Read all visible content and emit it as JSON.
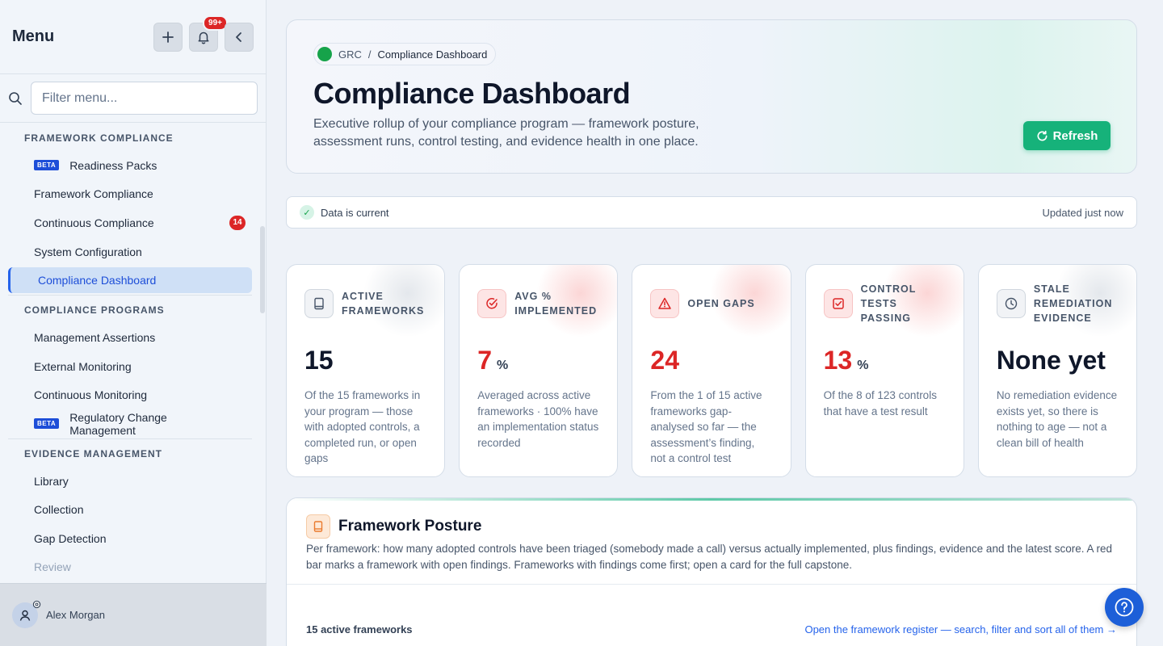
{
  "sidebar": {
    "title": "Menu",
    "notif_count": "99+",
    "filter_placeholder": "Filter menu...",
    "sections": [
      {
        "title": "FRAMEWORK COMPLIANCE"
      },
      {
        "title": "COMPLIANCE PROGRAMS"
      },
      {
        "title": "EVIDENCE MANAGEMENT"
      }
    ],
    "items": {
      "readiness": "Readiness Packs",
      "framework_compliance": "Framework Compliance",
      "continuous_compliance": "Continuous Compliance",
      "continuous_compliance_count": "14",
      "system_configuration": "System Configuration",
      "compliance_dashboard": "Compliance Dashboard",
      "management_assertions": "Management Assertions",
      "external_monitoring": "External Monitoring",
      "continuous_monitoring": "Continuous Monitoring",
      "regulatory_change": "Regulatory Change Management",
      "library": "Library",
      "collection": "Collection",
      "gap_detection": "Gap Detection",
      "review": "Review"
    },
    "beta_label": "BETA",
    "user_name": "Alex Morgan"
  },
  "hero": {
    "crumb_root": "GRC",
    "crumb_sep": "/",
    "crumb_current": "Compliance Dashboard",
    "title": "Compliance Dashboard",
    "description": "Executive rollup of your compliance program — framework posture, assessment runs, control testing, and evidence health in one place.",
    "refresh_label": "Refresh"
  },
  "status": {
    "text": "Data is current",
    "updated": "Updated just now"
  },
  "cards": [
    {
      "label": "ACTIVE FRAMEWORKS",
      "value": "15",
      "unit": "",
      "desc": "Of the 15 frameworks in your program — those with adopted controls, a completed run, or open gaps"
    },
    {
      "label": "AVG % IMPLEMENTED",
      "value": "7",
      "unit": "%",
      "desc": "Averaged across active frameworks · 100% have an implementation status recorded"
    },
    {
      "label": "OPEN GAPS",
      "value": "24",
      "unit": "",
      "desc": "From the 1 of 15 active frameworks gap-analysed so far — the assessment’s finding, not a control test"
    },
    {
      "label": "CONTROL TESTS PASSING",
      "value": "13",
      "unit": "%",
      "desc": "Of the 8 of 123 controls that have a test result"
    },
    {
      "label": "STALE REMEDIATION EVIDENCE",
      "value": "None yet",
      "unit": "",
      "desc": "No remediation evidence exists yet, so there is nothing to age — not a clean bill of health"
    }
  ],
  "posture": {
    "title": "Framework Posture",
    "description": "Per framework: how many adopted controls have been triaged (somebody made a call) versus actually implemented, plus findings, evidence and the latest score. A red bar marks a framework with open findings. Frameworks with findings come first; open a card for the full capstone.",
    "count": "15 active frameworks",
    "link": "Open the framework register — search, filter and sort all of them →"
  },
  "colors": {
    "accent": "#16b27a",
    "danger": "#dc2626",
    "link": "#2563eb"
  }
}
